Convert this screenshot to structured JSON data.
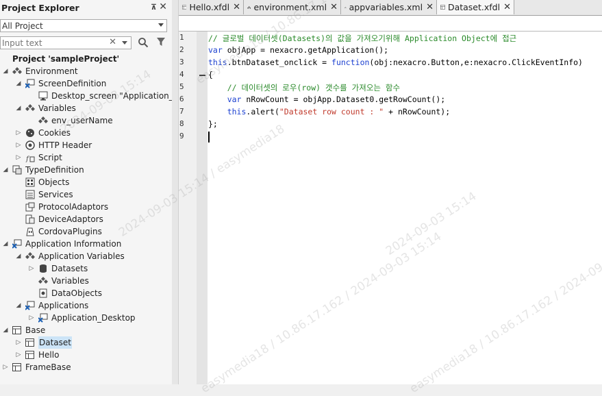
{
  "explorer": {
    "title": "Project Explorer",
    "pin": "⊼",
    "close": "✕",
    "scope": "All Project",
    "filter_placeholder": "Input text"
  },
  "tree": [
    {
      "label": "Project 'sampleProject'",
      "bold": true
    },
    {
      "label": "Environment"
    },
    {
      "label": "ScreenDefinition"
    },
    {
      "label": "Desktop_screen \"Application_Des"
    },
    {
      "label": "Variables"
    },
    {
      "label": "env_userName"
    },
    {
      "label": "Cookies"
    },
    {
      "label": "HTTP Header"
    },
    {
      "label": "Script"
    },
    {
      "label": "TypeDefinition"
    },
    {
      "label": "Objects"
    },
    {
      "label": "Services"
    },
    {
      "label": "ProtocolAdaptors"
    },
    {
      "label": "DeviceAdaptors"
    },
    {
      "label": "CordovaPlugins"
    },
    {
      "label": "Application Information"
    },
    {
      "label": "Application Variables"
    },
    {
      "label": "Datasets"
    },
    {
      "label": "Variables"
    },
    {
      "label": "DataObjects"
    },
    {
      "label": "Applications"
    },
    {
      "label": "Application_Desktop"
    },
    {
      "label": "Base"
    },
    {
      "label": "Dataset",
      "selected": true
    },
    {
      "label": "Hello"
    },
    {
      "label": "FrameBase"
    }
  ],
  "tabs": [
    {
      "label": "Hello.xfdl",
      "close": "✕"
    },
    {
      "label": "environment.xml",
      "close": "✕"
    },
    {
      "label": "appvariables.xml",
      "close": "✕"
    },
    {
      "label": "Dataset.xfdl",
      "close": "✕",
      "active": true
    }
  ],
  "editor": {
    "line_numbers": [
      "1",
      "2",
      "3",
      "4",
      "5",
      "6",
      "7",
      "8",
      "9"
    ],
    "lines": [
      [
        {
          "t": "// 글로벌 데이터셋(Datasets)의 값을 가져오기위해 Application Object에 접근",
          "c": "cm"
        }
      ],
      [
        {
          "t": "var",
          "c": "kw"
        },
        {
          "t": " objApp = nexacro.getApplication();",
          "c": ""
        }
      ],
      [
        {
          "t": "this",
          "c": "kw"
        },
        {
          "t": ".btnDataset_onclick = ",
          "c": ""
        },
        {
          "t": "function",
          "c": "kw"
        },
        {
          "t": "(obj:nexacro.Button,e:nexacro.ClickEventInfo)",
          "c": ""
        }
      ],
      [
        {
          "t": "{",
          "c": ""
        }
      ],
      [
        {
          "t": "    // 데이터셋의 로우(row) 갯수를 가져오는 함수",
          "c": "cm"
        }
      ],
      [
        {
          "t": "    ",
          "c": ""
        },
        {
          "t": "var",
          "c": "kw"
        },
        {
          "t": " nRowCount = objApp.Dataset0.getRowCount();",
          "c": ""
        }
      ],
      [
        {
          "t": "    ",
          "c": ""
        },
        {
          "t": "this",
          "c": "kw"
        },
        {
          "t": ".alert(",
          "c": ""
        },
        {
          "t": "\"Dataset row count : \"",
          "c": "str"
        },
        {
          "t": " + nRowCount);",
          "c": ""
        }
      ],
      [
        {
          "t": "};",
          "c": ""
        }
      ],
      [
        {
          "t": "",
          "c": ""
        }
      ]
    ]
  },
  "watermarks": [
    "easymedia18 / 10.86.17.162 / 2024-09-03 15:14",
    "2024-09-03 15:14",
    "2024-09-03 15:14 / easymedia18",
    "easymedia18 / 10.86.17.162 / 2024-09-03 15:14",
    "2024-09-03 15:14",
    "easymedia18 / 10.86.17.162 / 2024-09-03 15:14"
  ],
  "colors": {
    "comment": "#2a8a2a",
    "keyword": "#1a3fd0",
    "string": "#c0392b",
    "selection": "#cce4f7"
  }
}
